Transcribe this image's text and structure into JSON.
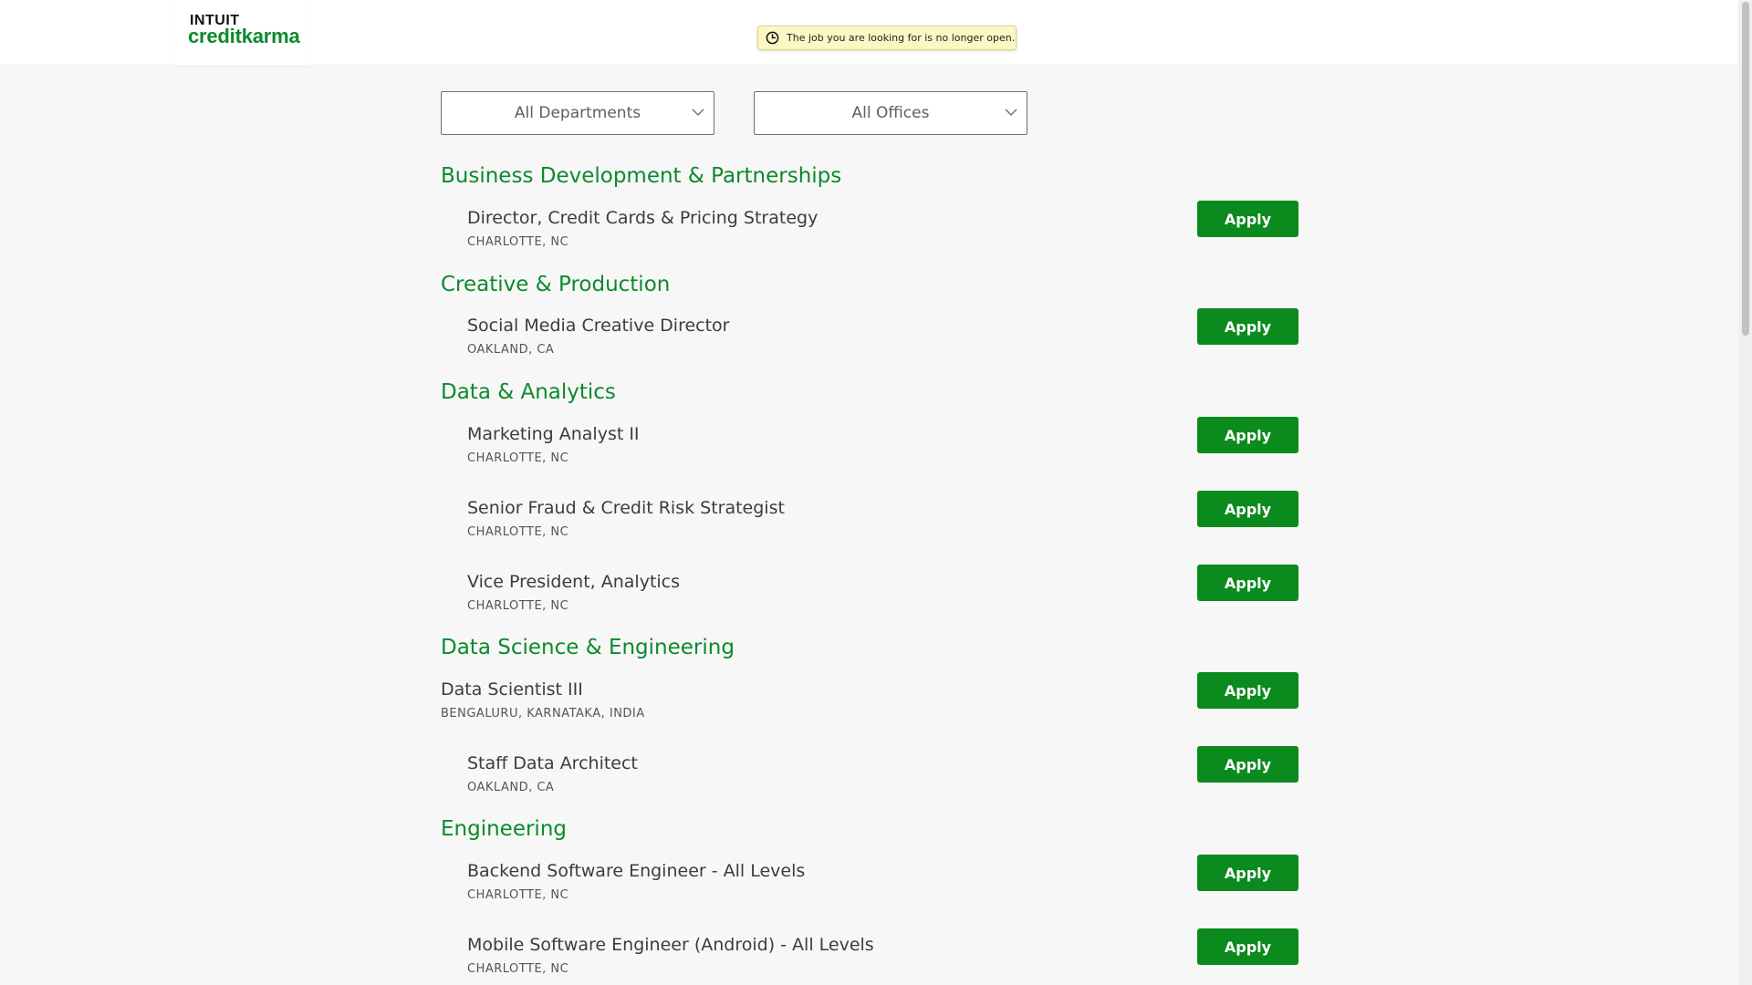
{
  "header": {
    "logo_top": "INTUIT",
    "logo_bottom": "creditkarma",
    "notice_text": "The job you are looking for is no longer open."
  },
  "filters": {
    "department": "All Departments",
    "office": "All Offices"
  },
  "departments": [
    {
      "name": "Business Development & Partnerships",
      "jobs": [
        {
          "title": "Director, Credit Cards & Pricing Strategy",
          "location": "CHARLOTTE, NC",
          "apply_label": "Apply"
        }
      ]
    },
    {
      "name": "Creative & Production",
      "jobs": [
        {
          "title": "Social Media Creative Director",
          "location": "OAKLAND, CA",
          "apply_label": "Apply"
        }
      ]
    },
    {
      "name": "Data & Analytics",
      "jobs": [
        {
          "title": "Marketing Analyst II",
          "location": "CHARLOTTE, NC",
          "apply_label": "Apply"
        },
        {
          "title": "Senior Fraud & Credit Risk Strategist",
          "location": "CHARLOTTE, NC",
          "apply_label": "Apply"
        },
        {
          "title": "Vice President, Analytics",
          "location": "CHARLOTTE, NC",
          "apply_label": "Apply"
        }
      ]
    },
    {
      "name": "Data Science & Engineering",
      "jobs": [
        {
          "title": "Data Scientist III",
          "location": "BENGALURU, KARNATAKA, INDIA",
          "apply_label": "Apply"
        },
        {
          "title": "Staff Data Architect",
          "location": "OAKLAND, CA",
          "apply_label": "Apply"
        }
      ]
    },
    {
      "name": "Engineering",
      "jobs": [
        {
          "title": "Backend Software Engineer - All Levels",
          "location": "CHARLOTTE, NC",
          "apply_label": "Apply"
        },
        {
          "title": "Mobile Software Engineer (Android) - All Levels",
          "location": "CHARLOTTE, NC",
          "apply_label": "Apply"
        }
      ]
    }
  ],
  "colors": {
    "brand_green": "#0b8a2b",
    "button_green": "#0b8a1e",
    "notice_bg": "#fdf7c4",
    "page_bg": "#f7f7f7"
  },
  "icons": {
    "notice": "clock-icon",
    "select": "chevron-down-icon"
  }
}
